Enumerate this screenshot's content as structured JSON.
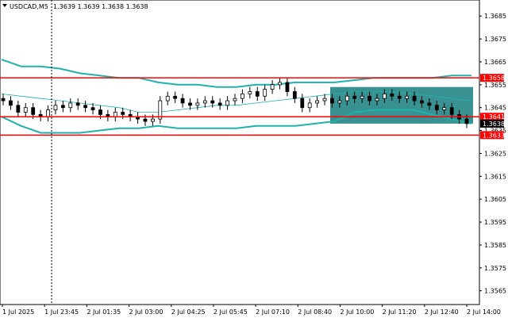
{
  "header": {
    "symbol": "USDCAD,M5",
    "ohlc": "1.3639 1.3639 1.3638 1.3638"
  },
  "chart_data": {
    "type": "candlestick",
    "symbol": "USDCAD",
    "timeframe": "M5",
    "ylim": [
      1.3559,
      1.3692
    ],
    "y_ticks": [
      "1.3685",
      "1.3675",
      "1.3665",
      "1.3655",
      "1.3645",
      "1.3635",
      "1.3625",
      "1.3615",
      "1.3605",
      "1.3595",
      "1.3585",
      "1.3575",
      "1.3565"
    ],
    "x_ticks": [
      "1 Jul 2025",
      "1 Jul 23:45",
      "2 Jul 01:35",
      "2 Jul 03:00",
      "2 Jul 04:25",
      "2 Jul 05:45",
      "2 Jul 07:10",
      "2 Jul 08:40",
      "2 Jul 10:00",
      "2 Jul 11:20",
      "2 Jul 12:40",
      "2 Jul 14:00"
    ],
    "levels": [
      {
        "label": "1.3658",
        "value": 1.3658,
        "color": "#ff0000"
      },
      {
        "label": "1.3641",
        "value": 1.3641,
        "color": "#ff0000"
      },
      {
        "label": "1.3633",
        "value": 1.3633,
        "color": "#ff0000"
      }
    ],
    "current_price": {
      "label": "1.3638",
      "value": 1.3638
    },
    "range_box": {
      "x_start": "2 Jul 09:45",
      "x_end": "2 Jul 14:00",
      "y_low": 1.3638,
      "y_high": 1.3654,
      "color": "#2e8b8b"
    },
    "bollinger": {
      "upper": [
        1.3666,
        1.3663,
        1.3663,
        1.3662,
        1.366,
        1.3659,
        1.3658,
        1.3658,
        1.3656,
        1.3655,
        1.3655,
        1.3654,
        1.3654,
        1.3655,
        1.3655,
        1.3656,
        1.3656,
        1.3656,
        1.3657,
        1.3658,
        1.3658,
        1.3658,
        1.3658,
        1.3659,
        1.3659
      ],
      "middle": [
        1.3651,
        1.365,
        1.3649,
        1.3648,
        1.3647,
        1.3646,
        1.3645,
        1.3643,
        1.3643,
        1.3644,
        1.3645,
        1.3646,
        1.3646,
        1.3647,
        1.3648,
        1.3649,
        1.365,
        1.3651,
        1.3652,
        1.3652,
        1.3652,
        1.3651,
        1.365,
        1.3649,
        1.3648
      ],
      "lower": [
        1.3641,
        1.3637,
        1.3634,
        1.3634,
        1.3634,
        1.3635,
        1.3636,
        1.3636,
        1.3637,
        1.3636,
        1.3636,
        1.3636,
        1.3636,
        1.3637,
        1.3637,
        1.3637,
        1.3638,
        1.3639,
        1.3643,
        1.3644,
        1.3644,
        1.3644,
        1.3642,
        1.364,
        1.3638
      ]
    },
    "close": [
      1.3648,
      1.3646,
      1.3643,
      1.3645,
      1.3642,
      1.3641,
      1.3644,
      1.3646,
      1.3645,
      1.3647,
      1.3646,
      1.3645,
      1.3644,
      1.3642,
      1.3641,
      1.3643,
      1.3642,
      1.3641,
      1.364,
      1.3639,
      1.364,
      1.3648,
      1.365,
      1.3649,
      1.3647,
      1.3646,
      1.3647,
      1.3648,
      1.3647,
      1.3646,
      1.3648,
      1.3649,
      1.3651,
      1.3652,
      1.365,
      1.3653,
      1.3655,
      1.3656,
      1.3652,
      1.3649,
      1.3645,
      1.3647,
      1.3648,
      1.3649,
      1.3647,
      1.3648,
      1.365,
      1.3649,
      1.365,
      1.3648,
      1.3649,
      1.3651,
      1.365,
      1.3649,
      1.365,
      1.3648,
      1.3647,
      1.3646,
      1.3644,
      1.3645,
      1.3642,
      1.364,
      1.3638
    ]
  }
}
